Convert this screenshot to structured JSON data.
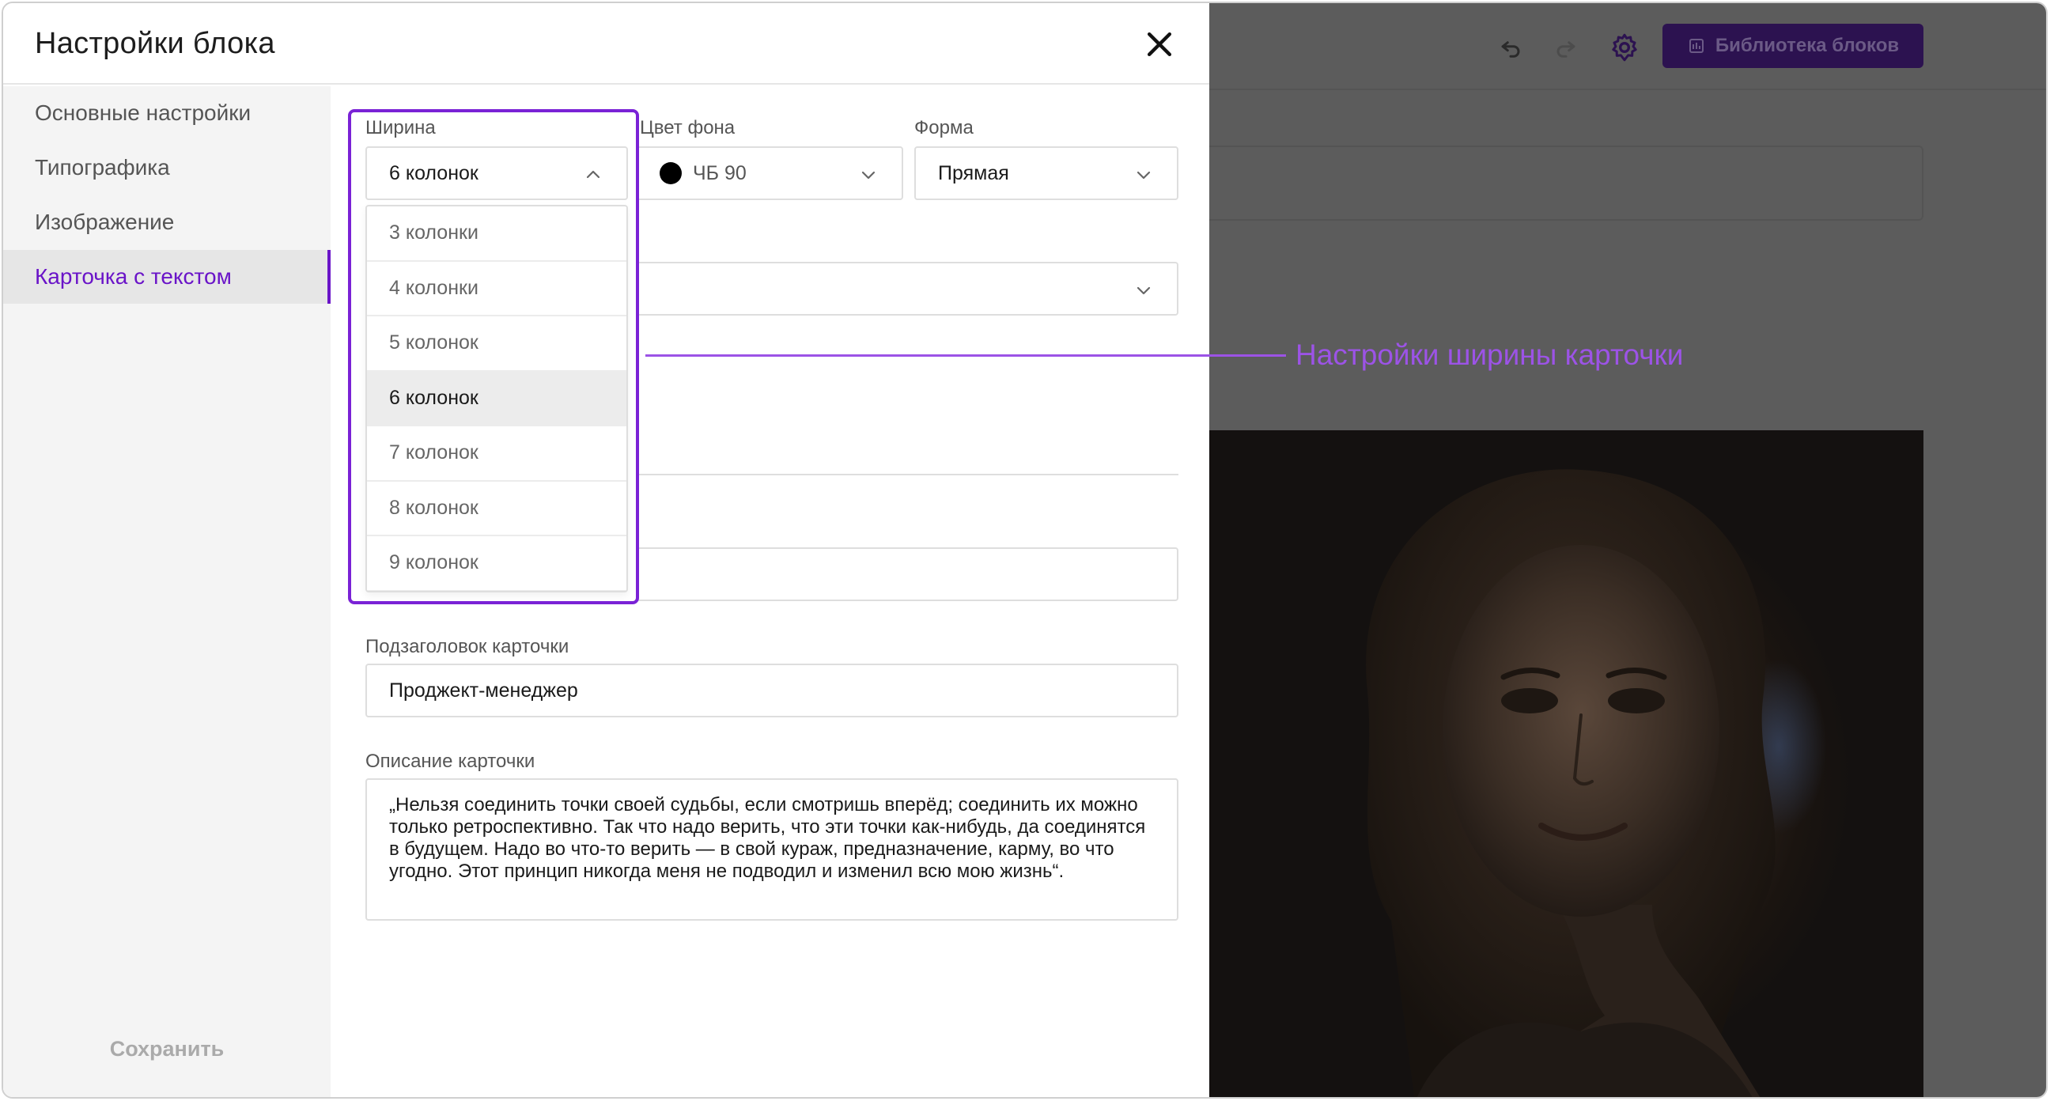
{
  "dialog": {
    "title": "Настройки блока",
    "save_label": "Сохранить"
  },
  "sidebar": {
    "items": [
      {
        "label": "Основные настройки",
        "active": false
      },
      {
        "label": "Типографика",
        "active": false
      },
      {
        "label": "Изображение",
        "active": false
      },
      {
        "label": "Карточка с текстом",
        "active": true
      }
    ]
  },
  "fields": {
    "width": {
      "label": "Ширина",
      "value": "6 колонок",
      "expanded": true
    },
    "bg_color": {
      "label": "Цвет фона",
      "value": "ЧБ 90",
      "swatch": "#000000"
    },
    "shape": {
      "label": "Форма",
      "value": "Прямая"
    },
    "subtitle": {
      "label": "Подзаголовок карточки",
      "value": "Проджект-менеджер"
    },
    "description": {
      "label": "Описание карточки",
      "value": "„Нельзя соединить точки своей судьбы, если смотришь вперёд; соединить их можно только ретроспективно. Так что надо верить, что эти точки как-нибудь, да соединятся в будущем. Надо во что-то верить — в свой кураж, предназначение, карму, во что угодно. Этот принцип никогда меня не подводил и изменил всю мою жизнь“."
    }
  },
  "width_options": [
    "3 колонки",
    "4 колонки",
    "5 колонок",
    "6 колонок",
    "7 колонок",
    "8 колонок",
    "9 колонок"
  ],
  "width_selected_index": 3,
  "annotation": {
    "text": "Настройки ширины карточки",
    "color": "#9c53e6"
  },
  "editor": {
    "library_button_label": "Библиотека блоков"
  },
  "colors": {
    "accent": "#6a14c8",
    "highlight": "#7a22d6"
  }
}
